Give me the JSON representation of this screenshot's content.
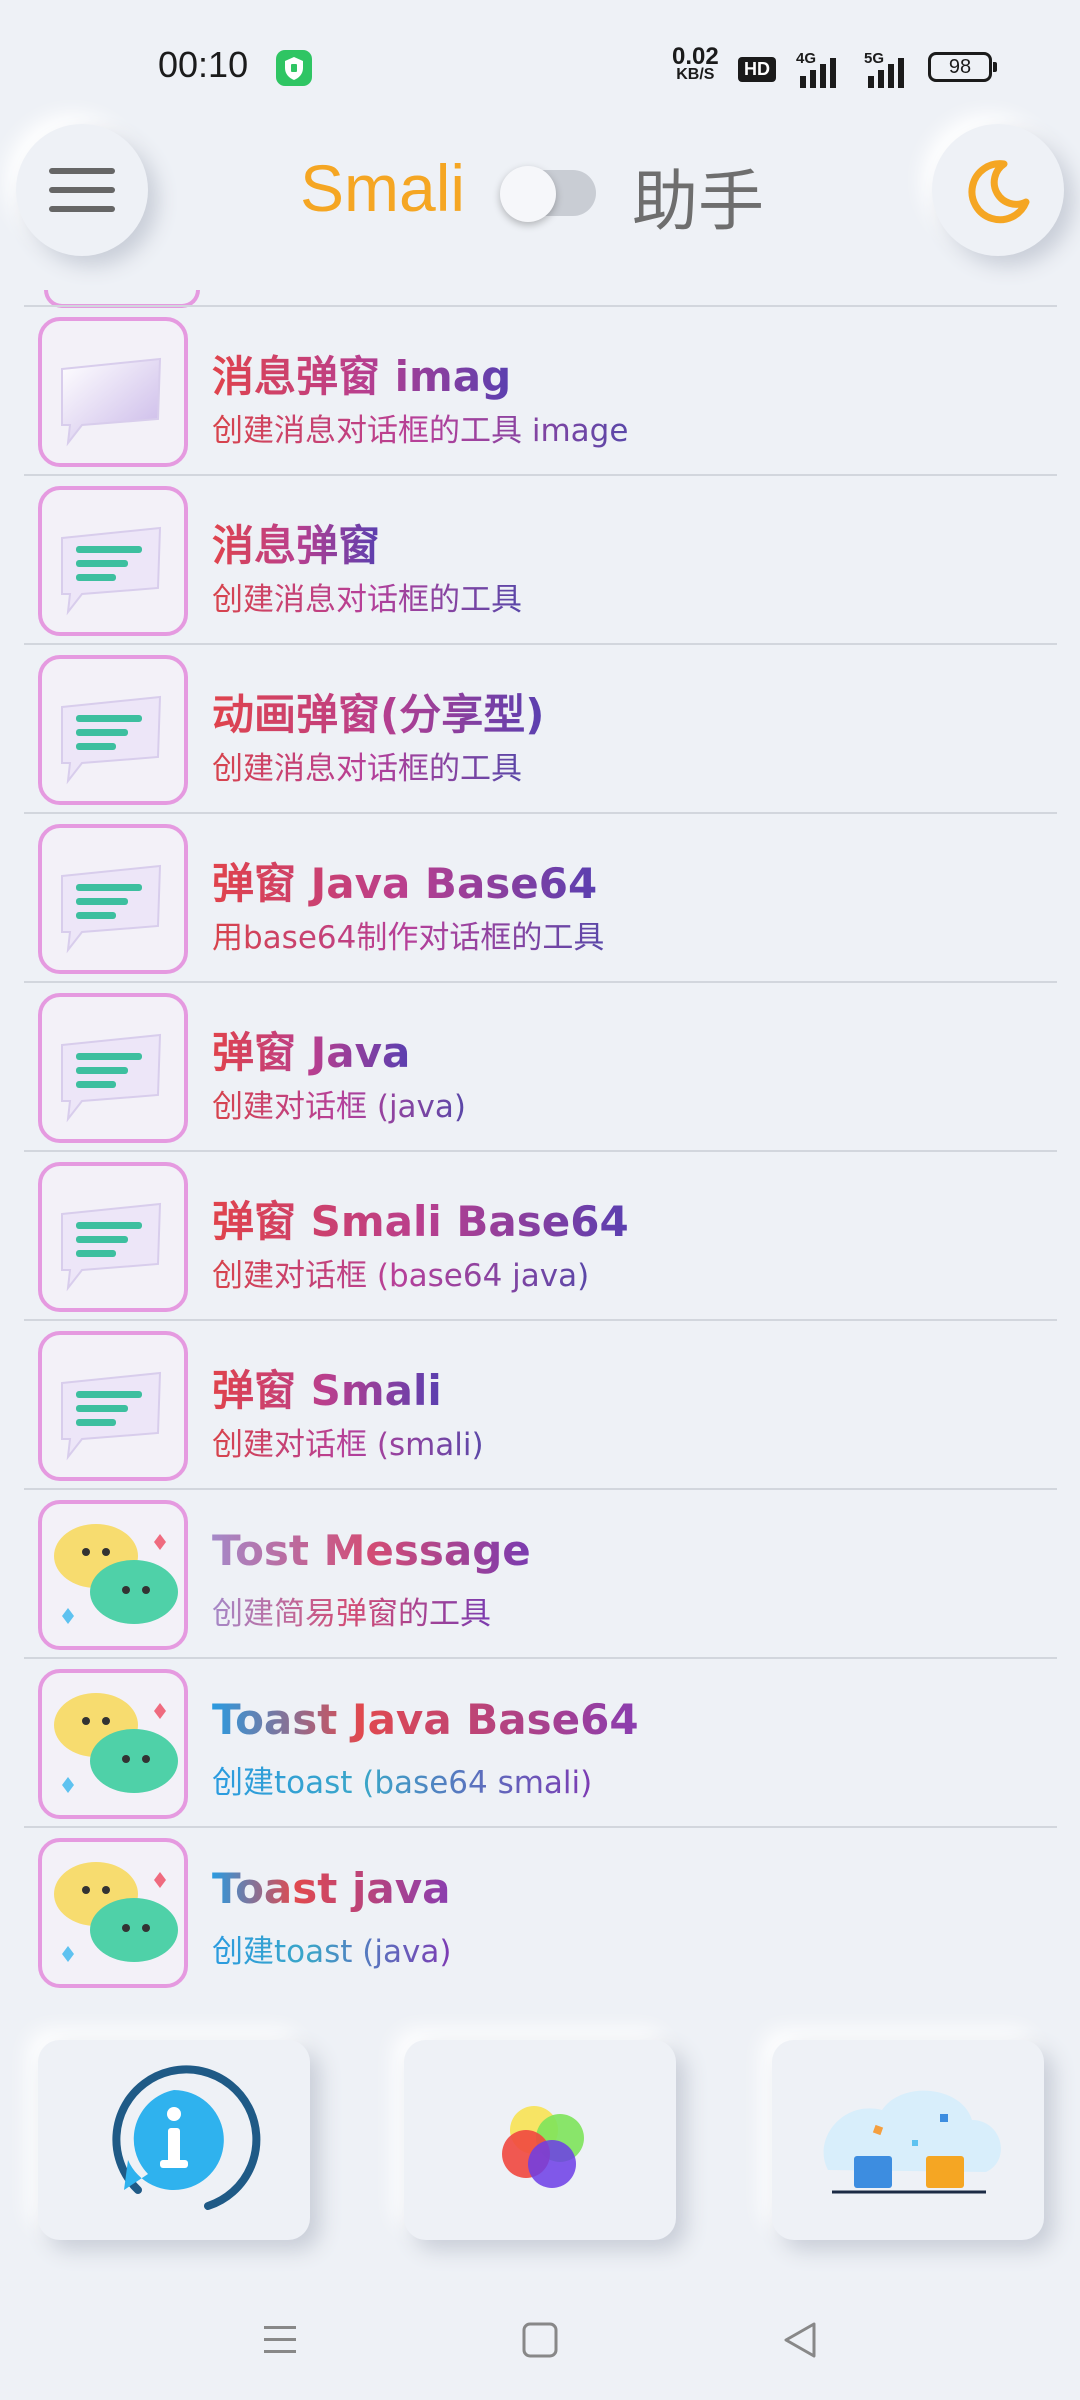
{
  "status_bar": {
    "time": "00:10",
    "net_speed_value": "0.02",
    "net_speed_unit": "KB/S",
    "hd_label": "HD",
    "signal1_label": "4G",
    "signal2_label": "5G",
    "battery": "98"
  },
  "header": {
    "title_left": "Smali",
    "title_right": "助手",
    "menu_icon": "hamburger-menu-icon",
    "theme_icon": "moon-icon",
    "toggle_on": false,
    "accent_color": "#f5a623"
  },
  "tools": [
    {
      "title": "消息弹窗 imag",
      "subtitle": "创建消息对话框的工具 image",
      "icon": "message-bubble-blank-icon"
    },
    {
      "title": "消息弹窗",
      "subtitle": "创建消息对话框的工具",
      "icon": "message-bubble-lines-icon"
    },
    {
      "title": "动画弹窗(分享型)",
      "subtitle": "创建消息对话框的工具",
      "icon": "message-bubble-lines-icon"
    },
    {
      "title": "弹窗 Java Base64",
      "subtitle": "用base64制作对话框的工具",
      "icon": "message-bubble-lines-icon"
    },
    {
      "title": "弹窗 Java",
      "subtitle": "创建对话框 (java)",
      "icon": "message-bubble-lines-icon"
    },
    {
      "title": "弹窗 Smali Base64",
      "subtitle": "创建对话框 (base64 java)",
      "icon": "message-bubble-lines-icon"
    },
    {
      "title": "弹窗 Smali",
      "subtitle": "创建对话框 (smali)",
      "icon": "message-bubble-lines-icon"
    },
    {
      "title": "Tost Message",
      "subtitle": "创建简易弹窗的工具",
      "icon": "chat-emoji-bubbles-icon"
    },
    {
      "title": "Toast Java Base64",
      "subtitle": "创建toast (base64 smali)",
      "icon": "chat-emoji-bubbles-icon"
    },
    {
      "title": "Toast java",
      "subtitle": "创建toast (java)",
      "icon": "chat-emoji-bubbles-icon"
    }
  ],
  "bottom_tiles": [
    "info-icon",
    "color-circles-icon",
    "folders-illustration-icon"
  ],
  "nav_bar": [
    "recents-menu-icon",
    "home-square-icon",
    "back-triangle-icon"
  ]
}
